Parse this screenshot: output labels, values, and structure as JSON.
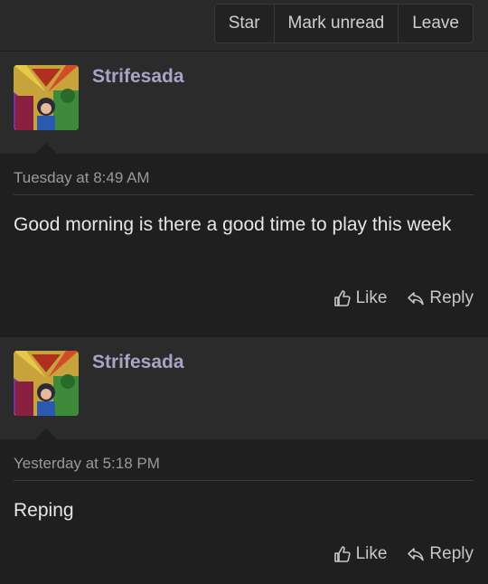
{
  "toolbar": {
    "star_label": "Star",
    "mark_unread_label": "Mark unread",
    "leave_label": "Leave"
  },
  "messages": [
    {
      "username": "Strifesada",
      "timestamp": "Tuesday at 8:49 AM",
      "content": "Good morning is there a good time to play this week",
      "like_label": "Like",
      "reply_label": "Reply"
    },
    {
      "username": "Strifesada",
      "timestamp": "Yesterday at 5:18 PM",
      "content": "Reping",
      "like_label": "Like",
      "reply_label": "Reply"
    }
  ],
  "colors": {
    "accent_username": "#a9a3c6",
    "background": "#242424"
  }
}
